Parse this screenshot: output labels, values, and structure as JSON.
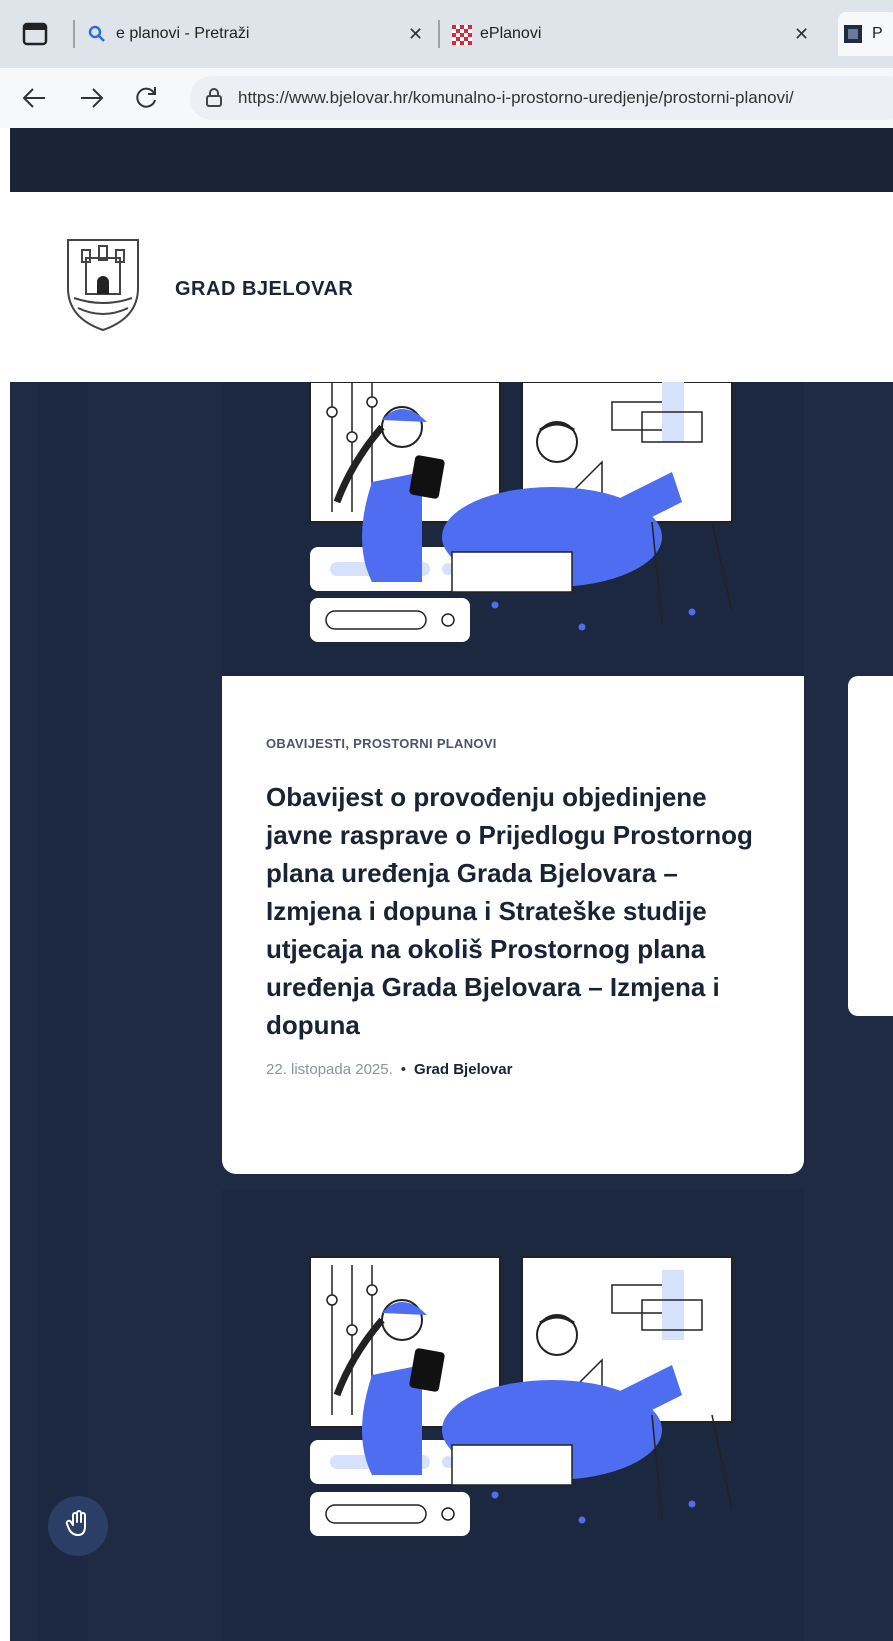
{
  "browser": {
    "tabs": [
      {
        "title": "e planovi - Pretraži",
        "favicon": "search-icon"
      },
      {
        "title": "ePlanovi",
        "favicon": "eplanovi-logo-icon"
      },
      {
        "title": "P",
        "favicon": "site-favicon"
      }
    ],
    "url": "https://www.bjelovar.hr/komunalno-i-prostorno-uredjenje/prostorni-planovi/"
  },
  "site": {
    "name": "GRAD BJELOVAR",
    "colors": {
      "dark": "#1f2b42",
      "accent": "#4f6df0"
    }
  },
  "posts": [
    {
      "category": "OBAVIJESTI, PROSTORNI PLANOVI",
      "title": "Obavijest o provođenju objedinjene javne rasprave o Prijedlogu Prostornog plana uređenja Grada Bjelovara – Izmjena i dopuna i Strateške studije utjecaja na okoliš Prostornog plana uređenja Grada Bjelovara – Izmjena i dopuna",
      "date": "22. listopada 2025.",
      "separator": "•",
      "author": "Grad Bjelovar"
    }
  ],
  "accessibility": {
    "icon": "hand-icon"
  }
}
